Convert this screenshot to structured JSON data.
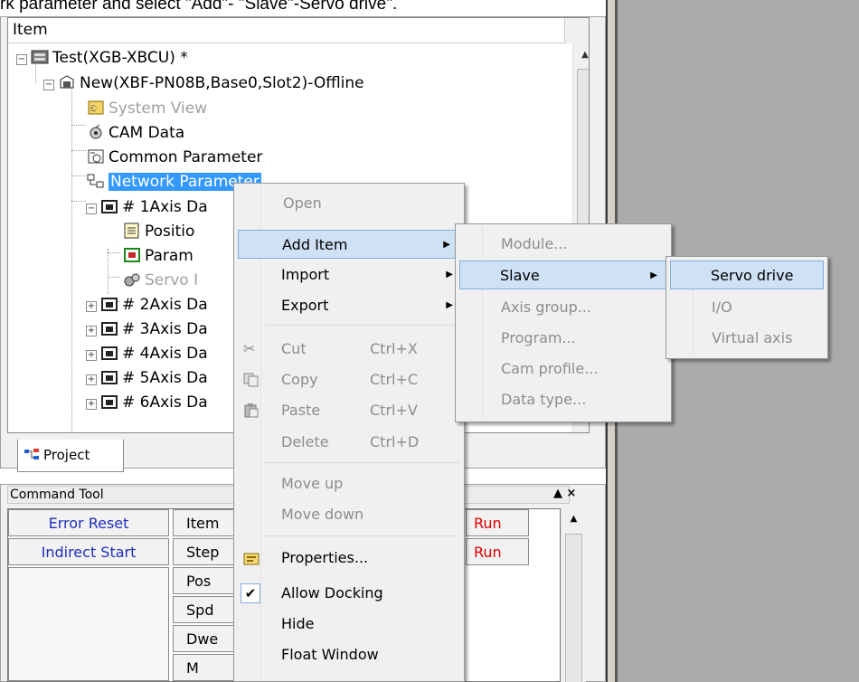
{
  "caption": "rk parameter and select \"Add\"- \"Slave\"-Servo drive\".",
  "project": {
    "header": "Item",
    "tab_label": "Project",
    "tree": [
      {
        "label": "Test(XGB-XBCU) *",
        "state": "normal"
      },
      {
        "label": "New(XBF-PN08B,Base0,Slot2)-Offline",
        "state": "normal"
      },
      {
        "label": "System View",
        "state": "muted"
      },
      {
        "label": "CAM Data",
        "state": "normal"
      },
      {
        "label": "Common Parameter",
        "state": "normal"
      },
      {
        "label": "Network Parameter",
        "state": "selected"
      },
      {
        "label": "# 1Axis Da",
        "state": "normal"
      },
      {
        "label": "Positio",
        "state": "normal"
      },
      {
        "label": "Param",
        "state": "normal"
      },
      {
        "label": "Servo I",
        "state": "muted"
      },
      {
        "label": "# 2Axis Da",
        "state": "normal"
      },
      {
        "label": "# 3Axis Da",
        "state": "normal"
      },
      {
        "label": "# 4Axis Da",
        "state": "normal"
      },
      {
        "label": "# 5Axis Da",
        "state": "normal"
      },
      {
        "label": "# 6Axis Da",
        "state": "normal"
      }
    ]
  },
  "command_tool": {
    "title": "Command Tool",
    "buttons": [
      "▲ ×"
    ],
    "left_col": [
      "Error Reset",
      "Indirect Start"
    ],
    "mid_col": [
      "Item",
      "Step",
      "Pos",
      "Spd",
      "Dwe",
      "M Code"
    ],
    "run_col": [
      "Run",
      "Run"
    ]
  },
  "context_menu": {
    "items": [
      {
        "label": "Open",
        "disabled": true
      },
      {
        "label": "Add Item",
        "submenu": true,
        "highlight": true
      },
      {
        "label": "Import",
        "submenu": true
      },
      {
        "label": "Export",
        "submenu": true
      },
      {
        "label": "Cut",
        "shortcut": "Ctrl+X",
        "disabled": true
      },
      {
        "label": "Copy",
        "shortcut": "Ctrl+C",
        "disabled": true
      },
      {
        "label": "Paste",
        "shortcut": "Ctrl+V",
        "disabled": true
      },
      {
        "label": "Delete",
        "shortcut": "Ctrl+D",
        "disabled": true
      },
      {
        "label": "Move up",
        "disabled": true
      },
      {
        "label": "Move down",
        "disabled": true
      },
      {
        "label": "Properties..."
      },
      {
        "label": "Allow Docking",
        "checked": true
      },
      {
        "label": "Hide"
      },
      {
        "label": "Float Window"
      }
    ]
  },
  "add_item_menu": {
    "items": [
      {
        "label": "Module...",
        "disabled": true
      },
      {
        "label": "Slave",
        "submenu": true,
        "highlight": true
      },
      {
        "label": "Axis group...",
        "disabled": true
      },
      {
        "label": "Program...",
        "disabled": true
      },
      {
        "label": "Cam profile...",
        "disabled": true
      },
      {
        "label": "Data type...",
        "disabled": true
      }
    ]
  },
  "slave_menu": {
    "items": [
      {
        "label": "Servo drive",
        "highlight": true
      },
      {
        "label": "I/O",
        "disabled": true
      },
      {
        "label": "Virtual axis",
        "disabled": true
      }
    ]
  }
}
